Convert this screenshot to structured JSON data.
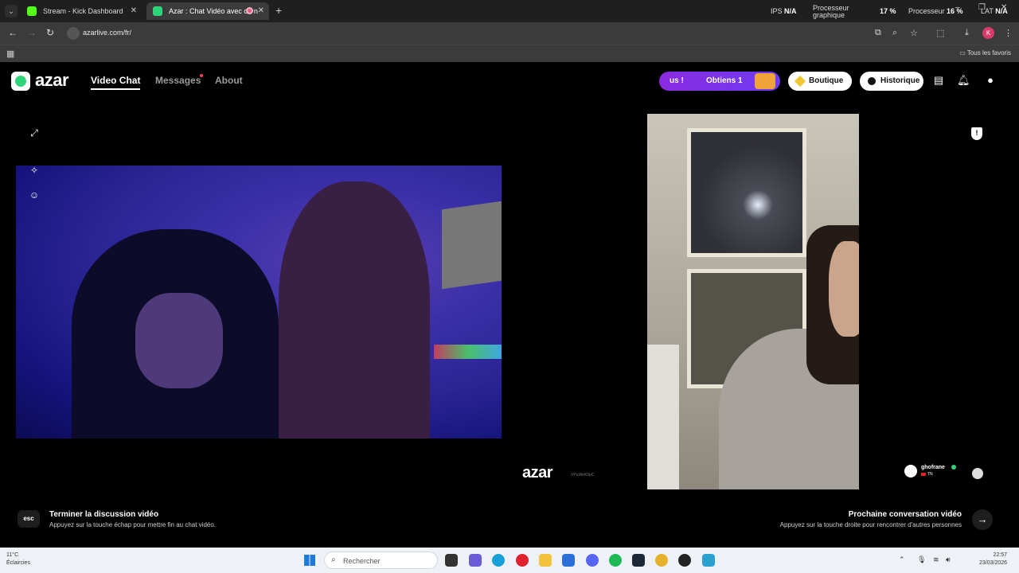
{
  "browser": {
    "tabs": [
      {
        "title": "Stream - Kick Dashboard",
        "favicon_color": "#53fc18"
      },
      {
        "title": "Azar : Chat Vidéo avec de n",
        "favicon_color": "#2ed47a"
      }
    ],
    "url": "azarlive.com/fr/",
    "bookmarks_all": "Tous les favoris",
    "perf": {
      "ips_label": "IPS",
      "ips_value": "N/A",
      "gpu_label_1": "Processeur",
      "gpu_label_2": "graphique",
      "gpu_value": "17 %",
      "cpu_label": "Processeur",
      "cpu_value": "16 %",
      "lat_label": "LAT",
      "lat_value": "N/A"
    }
  },
  "header": {
    "logo_text": "azar",
    "nav": [
      "Video Chat",
      "Messages",
      "About"
    ],
    "promo_left": "us !",
    "promo_main": "Obtiens 1",
    "shop": "Boutique",
    "history": "Historique"
  },
  "call": {
    "watermark": "azar",
    "watermark_id": "VPuWeK0pC",
    "peer_name": "ghofrane",
    "peer_country": "TN"
  },
  "hints": {
    "esc_key": "esc",
    "end_title": "Terminer la discussion vidéo",
    "end_sub": "Appuyez sur la touche échap pour mettre fin au chat vidéo.",
    "next_title": "Prochaine conversation vidéo",
    "next_sub": "Appuyez sur la touche droite pour rencontrer d'autres personnes"
  },
  "taskbar": {
    "temp": "11°C",
    "weather": "Éclaircies",
    "search_placeholder": "Rechercher",
    "time": "22:57",
    "date": "23/03/2026"
  },
  "colors": {
    "accent_green": "#2ed47a",
    "promo_purple": "#8b2be2"
  }
}
